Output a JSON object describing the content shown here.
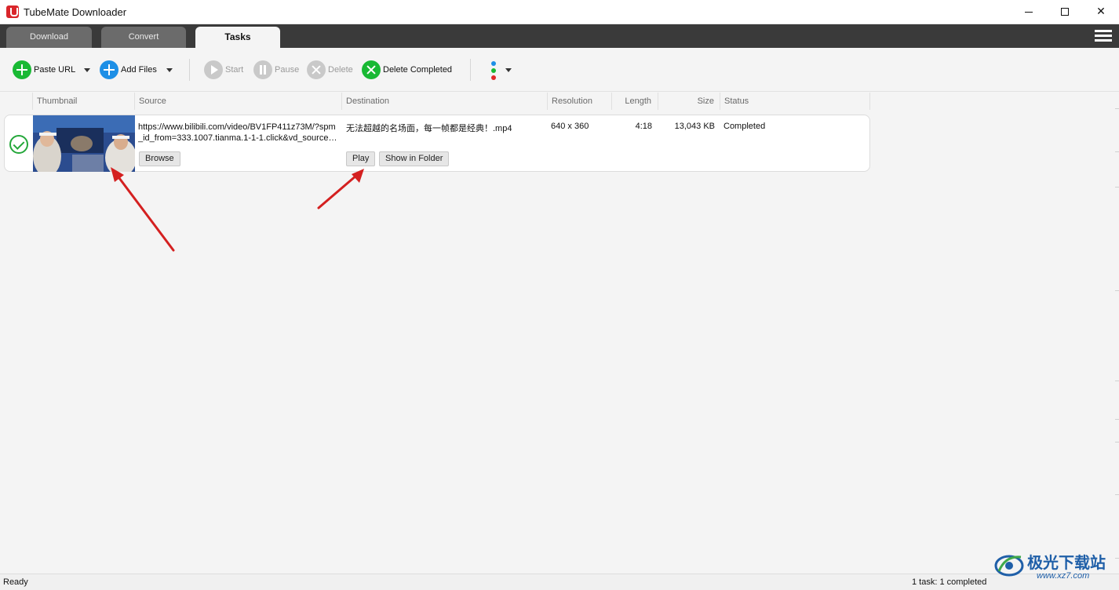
{
  "window": {
    "title": "TubeMate Downloader",
    "min_glyph": "",
    "max_glyph": "",
    "close_glyph": "✕"
  },
  "tabs": [
    {
      "label": "Download",
      "active": false
    },
    {
      "label": "Convert",
      "active": false
    },
    {
      "label": "Tasks",
      "active": true
    }
  ],
  "toolbar": {
    "paste_url": "Paste URL",
    "add_files": "Add Files",
    "start": "Start",
    "pause": "Pause",
    "delete": "Delete",
    "delete_completed": "Delete Completed"
  },
  "columns": {
    "thumbnail": "Thumbnail",
    "source": "Source",
    "destination": "Destination",
    "resolution": "Resolution",
    "length": "Length",
    "size": "Size",
    "status": "Status"
  },
  "tasks": [
    {
      "source_line1": "https://www.bilibili.com/video/BV1FP411z73M/?spm",
      "source_line2": "_id_from=333.1007.tianma.1-1-1.click&vd_source=...",
      "destination": "无法超越的名场面，每一帧都是经典！.mp4",
      "resolution": "640 x 360",
      "length": "4:18",
      "size": "13,043 KB",
      "status": "Completed",
      "browse_label": "Browse",
      "play_label": "Play",
      "show_folder_label": "Show in Folder"
    }
  ],
  "statusbar": {
    "left": "Ready",
    "right": "1 task: 1 completed"
  },
  "watermark": {
    "name": "极光下载站",
    "url": "www.xz7.com"
  },
  "colors": {
    "accent_green": "#19b934",
    "accent_blue": "#1d8fe6",
    "tabbar_bg": "#3a3a3a",
    "annotation_arrow": "#d42020"
  }
}
